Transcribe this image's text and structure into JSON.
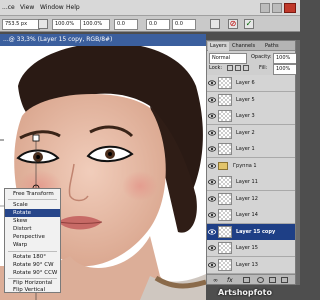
{
  "menu": {
    "items": [
      "...ce",
      "View",
      "Window",
      "Help"
    ]
  },
  "options": {
    "x_value": "753.5 px",
    "w_value": "100.0%",
    "h_value": "100.0%",
    "angle_value": "0.0",
    "h_skew": "0.0",
    "v_skew": "0.0"
  },
  "document": {
    "title": "...@ 33,3% (Layer 15 copy, RGB/8#)"
  },
  "context_menu": {
    "items": [
      {
        "label": "Free Transform",
        "selected": false
      },
      {
        "label": "Scale",
        "selected": false
      },
      {
        "label": "Rotate",
        "selected": true
      },
      {
        "label": "Skew",
        "selected": false
      },
      {
        "label": "Distort",
        "selected": false
      },
      {
        "label": "Perspective",
        "selected": false
      },
      {
        "label": "Warp",
        "selected": false
      },
      {
        "label": "Rotate 180°",
        "selected": false
      },
      {
        "label": "Rotate 90° CW",
        "selected": false
      },
      {
        "label": "Rotate 90° CCW",
        "selected": false
      },
      {
        "label": "Flip Horizontal",
        "selected": false
      },
      {
        "label": "Flip Vertical",
        "selected": false
      }
    ]
  },
  "layers_panel": {
    "tabs": [
      "Layers",
      "Channels",
      "Paths"
    ],
    "blend_mode": "Normal",
    "opacity_label": "Opacity:",
    "opacity_value": "100%",
    "lock_label": "Lock:",
    "fill_label": "Fill:",
    "fill_value": "100%",
    "layers": [
      {
        "name": "Layer 6",
        "selected": false,
        "type": "layer"
      },
      {
        "name": "Layer 5",
        "selected": false,
        "type": "layer"
      },
      {
        "name": "Layer 3",
        "selected": false,
        "type": "layer"
      },
      {
        "name": "Layer 2",
        "selected": false,
        "type": "layer"
      },
      {
        "name": "Layer 1",
        "selected": false,
        "type": "layer"
      },
      {
        "name": "Группа 1",
        "selected": false,
        "type": "group"
      },
      {
        "name": "Layer 11",
        "selected": false,
        "type": "layer"
      },
      {
        "name": "Layer 12",
        "selected": false,
        "type": "layer"
      },
      {
        "name": "Layer 14",
        "selected": false,
        "type": "layer"
      },
      {
        "name": "Layer 15 copy",
        "selected": true,
        "type": "layer"
      },
      {
        "name": "Layer 15",
        "selected": false,
        "type": "layer"
      },
      {
        "name": "Layer 13",
        "selected": false,
        "type": "layer"
      }
    ]
  },
  "watermark": "Artshopfoto",
  "colors": {
    "selection": "#1e3f86",
    "title_bar": "#3b5f9e",
    "panel": "#cfcfcf"
  }
}
